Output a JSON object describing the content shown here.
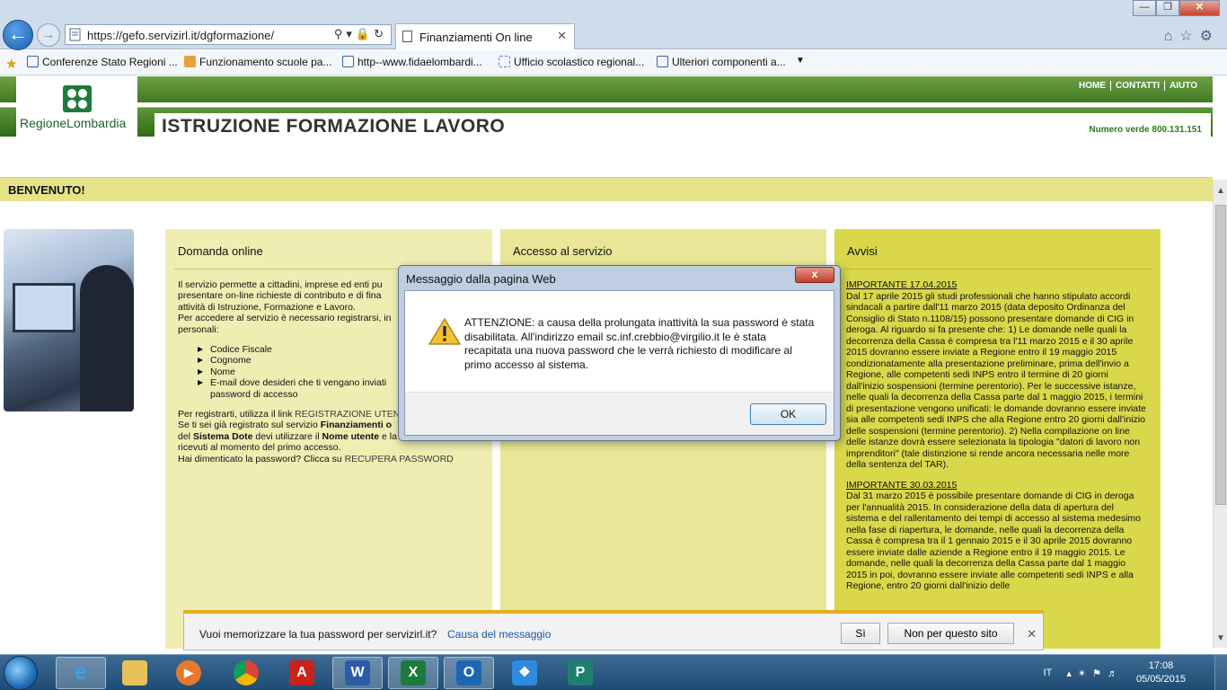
{
  "browser": {
    "url": "https://gefo.servizirl.it/dgformazione/",
    "tab_title": "Finanziamenti On line",
    "favorites": [
      "Conferenze Stato Regioni ...",
      "Funzionamento scuole pa...",
      "http--www.fidaelombardi...",
      "Ufficio scolastico regional...",
      "Ulteriori componenti a..."
    ]
  },
  "site": {
    "logo_text": "RegioneLombardia",
    "title": "ISTRUZIONE FORMAZIONE LAVORO",
    "toll_free": "Numero verde 800.131.151",
    "nav": [
      "HOME",
      "CONTATTI",
      "AIUTO"
    ],
    "welcome": "BENVENUTO!"
  },
  "columns": {
    "online": {
      "title": "Domanda online",
      "intro_1": "Il servizio permette a cittadini, imprese ed enti pu",
      "intro_2": "presentare on-line richieste di contributo e di fina",
      "intro_3": "attività di Istruzione, Formazione e Lavoro.",
      "intro_4": "Per accedere al servizio è necessario registrarsi, in",
      "intro_5": "personali:",
      "items": [
        "Codice Fiscale",
        "Cognome",
        "Nome",
        "E-mail dove desideri che ti vengano inviati",
        "password di accesso"
      ],
      "reg_prefix": "Per registrarti, utilizza il link ",
      "reg_link": "REGISTRAZIONE UTEN",
      "p2_line1_a": "Se ti sei già registrato sul servizio ",
      "p2_line1_b": "Finanziamenti o",
      "p2_line2_a": "del ",
      "p2_line2_b": "Sistema Dote",
      "p2_line2_c": " devi utilizzare il ",
      "p2_line2_d": "Nome utente",
      "p2_line2_e": " e la Password",
      "p2_line3": "ricevuti al momento del primo accesso.",
      "forgot_prefix": "Hai dimenticato la password? Clicca su ",
      "forgot_link": "RECUPERA PASSWORD"
    },
    "access": {
      "title": "Accesso al servizio"
    },
    "avvisi": {
      "title": "Avvisi",
      "notices": [
        {
          "heading": "IMPORTANTE 17.04.2015",
          "text": "Dal 17 aprile 2015 gli studi professionali che hanno stipulato accordi sindacali a partire dall'11 marzo 2015 (data deposito Ordinanza del Consiglio di Stato n.1108/15) possono presentare domande di CIG in deroga. Al riguardo si fa presente che: 1) Le domande nelle quali la decorrenza della Cassa è compresa tra l'11 marzo 2015 e il 30 aprile 2015 dovranno essere inviate a Regione entro il 19 maggio 2015 condizionatamente alla presentazione preliminare, prima dell'invio a Regione, alle competenti sedi INPS entro il termine di 20 giorni dall'inizio sospensioni (termine perentorio). Per le successive istanze, nelle quali la decorrenza della Cassa parte dal 1 maggio 2015, i termini di presentazione vengono unificati: le domande dovranno essere inviate sia alle competenti sedi INPS che alla Regione entro 20 giorni dall'inizio delle sospensioni (termine perentorio). 2) Nella compilazione on line delle istanze dovrà essere selezionata la tipologia \"datori di lavoro non imprenditori\" (tale distinzione si rende ancora necessaria nelle more della sentenza del TAR)."
        },
        {
          "heading": "IMPORTANTE 30.03.2015",
          "text": "Dal 31 marzo 2015 è possibile presentare domande di CIG in deroga per l'annualità 2015. In considerazione della data di apertura del sistema e del rallentamento dei tempi di accesso al sistema medesimo nella fase di riapertura, le domande, nelle quali la decorrenza della Cassa è compresa tra il 1 gennaio 2015 e il 30 aprile 2015 dovranno essere inviate dalle aziende a Regione entro il 19 maggio 2015. Le domande, nelle quali la decorrenza della Cassa parte dal 1 maggio 2015 in poi, dovranno essere inviate alle competenti sedi INPS e alla Regione, entro 20 giorni dall'inizio delle"
        }
      ]
    }
  },
  "dialog": {
    "title": "Messaggio dalla pagina Web",
    "close_label": "x",
    "message": "ATTENZIONE: a causa della prolungata inattività la sua password è stata disabilitata. All'indirizzo email sc.inf.crebbio@virgilio.it le è stata recapitata una nuova password che le verrà richiesto di modificare al primo accesso al sistema.",
    "ok_label": "OK"
  },
  "notification": {
    "message": "Vuoi memorizzare la tua password per servizirl.it?",
    "link": "Causa del messaggio",
    "yes_label": "Sì",
    "no_label": "Non per questo sito"
  },
  "taskbar": {
    "language": "IT",
    "time": "17:08",
    "date": "05/05/2015"
  },
  "colors": {
    "green_header": "#3f7a22",
    "welcome_bar": "#e6e38a",
    "col_online": "#efedb2",
    "col_access": "#e9e797",
    "col_avvisi": "#d8d84a"
  }
}
